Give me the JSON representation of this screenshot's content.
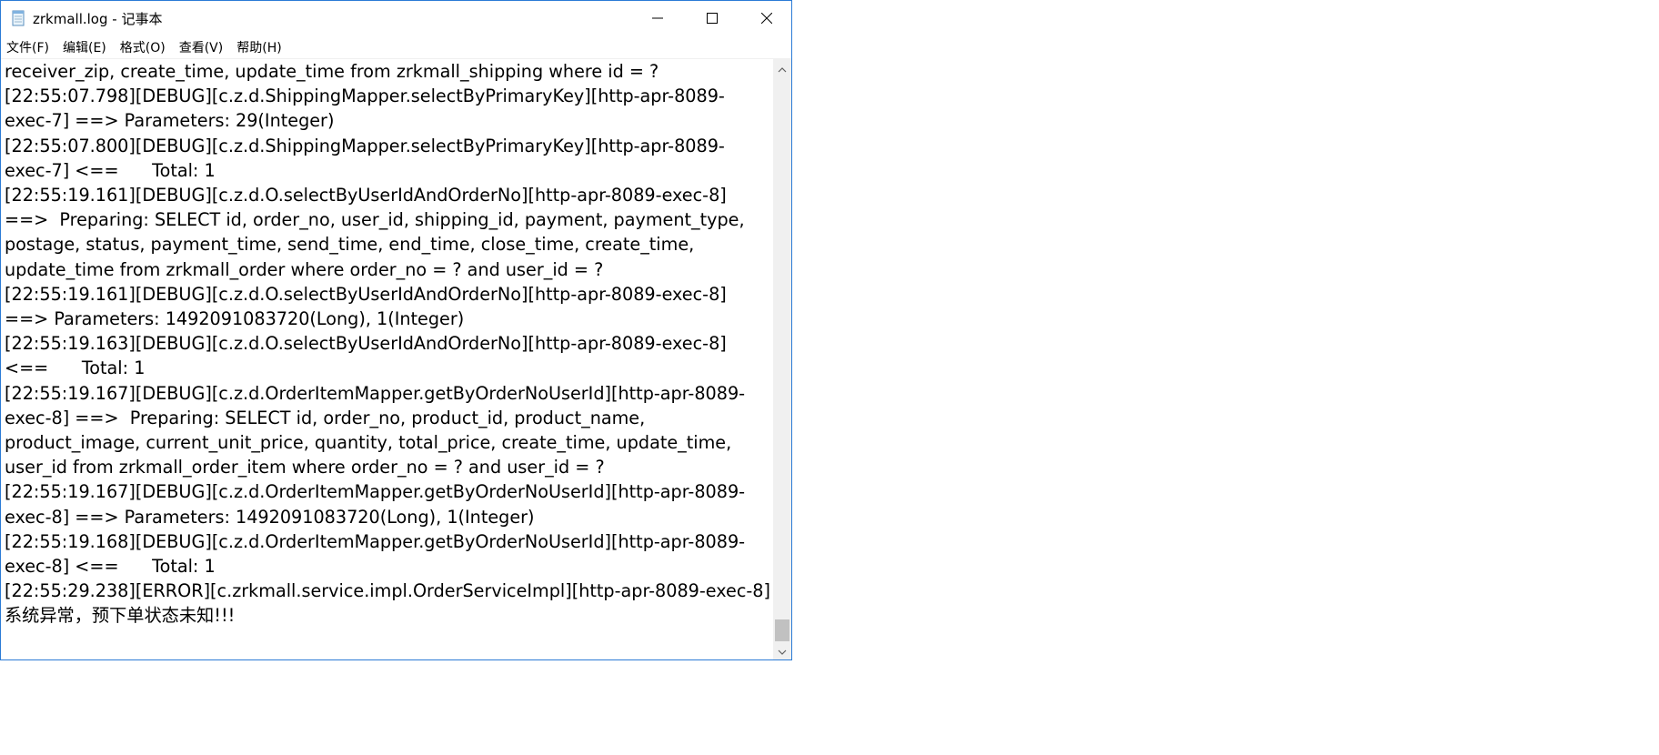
{
  "window": {
    "title": "zrkmall.log - 记事本"
  },
  "menu": {
    "items": [
      {
        "label": "文件(F)"
      },
      {
        "label": "编辑(E)"
      },
      {
        "label": "格式(O)"
      },
      {
        "label": "查看(V)"
      },
      {
        "label": "帮助(H)"
      }
    ]
  },
  "editor": {
    "lines": [
      "receiver_zip, create_time, update_time from zrkmall_shipping where id = ?",
      "[22:55:07.798][DEBUG][c.z.d.ShippingMapper.selectByPrimaryKey][http-apr-8089-",
      "exec-7] ==> Parameters: 29(Integer)",
      "[22:55:07.800][DEBUG][c.z.d.ShippingMapper.selectByPrimaryKey][http-apr-8089-",
      "exec-7] <==      Total: 1",
      "[22:55:19.161][DEBUG][c.z.d.O.selectByUserIdAndOrderNo][http-apr-8089-exec-8]",
      "==>  Preparing: SELECT id, order_no, user_id, shipping_id, payment, payment_type,",
      "postage, status, payment_time, send_time, end_time, close_time, create_time,",
      "update_time from zrkmall_order where order_no = ? and user_id = ?",
      "[22:55:19.161][DEBUG][c.z.d.O.selectByUserIdAndOrderNo][http-apr-8089-exec-8]",
      "==> Parameters: 1492091083720(Long), 1(Integer)",
      "[22:55:19.163][DEBUG][c.z.d.O.selectByUserIdAndOrderNo][http-apr-8089-exec-8]",
      "<==      Total: 1",
      "[22:55:19.167][DEBUG][c.z.d.OrderItemMapper.getByOrderNoUserId][http-apr-8089-",
      "exec-8] ==>  Preparing: SELECT id, order_no, product_id, product_name,",
      "product_image, current_unit_price, quantity, total_price, create_time, update_time,",
      "user_id from zrkmall_order_item where order_no = ? and user_id = ?",
      "[22:55:19.167][DEBUG][c.z.d.OrderItemMapper.getByOrderNoUserId][http-apr-8089-",
      "exec-8] ==> Parameters: 1492091083720(Long), 1(Integer)",
      "[22:55:19.168][DEBUG][c.z.d.OrderItemMapper.getByOrderNoUserId][http-apr-8089-",
      "exec-8] <==      Total: 1",
      "[22:55:29.238][ERROR][c.zrkmall.service.impl.OrderServiceImpl][http-apr-8089-exec-8]",
      "系统异常，预下单状态未知!!!"
    ]
  },
  "icons": {
    "app": "notepad-icon",
    "minimize": "minimize-icon",
    "maximize": "maximize-icon",
    "close": "close-icon",
    "scroll_up": "chevron-up-icon",
    "scroll_down": "chevron-down-icon"
  },
  "colors": {
    "window_border": "#2b7bd6",
    "scrollbar_track": "#f0f0f0",
    "scrollbar_thumb": "#c1c1c1"
  },
  "scroll": {
    "position_fraction": 1.0
  }
}
